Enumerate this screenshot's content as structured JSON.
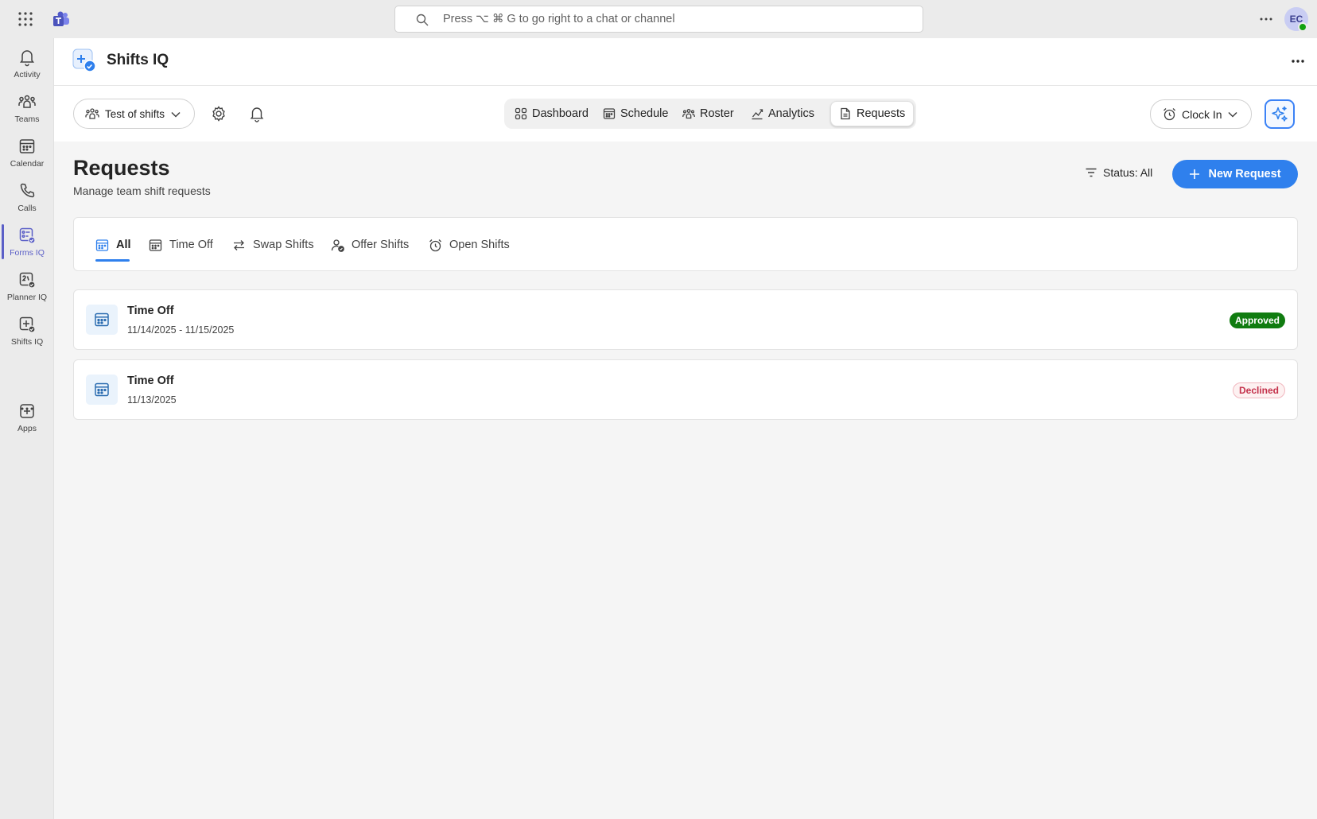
{
  "titlebar": {
    "search_placeholder": "Press ⌥ ⌘ G to go right to a chat or channel",
    "avatar_initials": "EC"
  },
  "rail": {
    "items": [
      {
        "label": "Activity",
        "icon": "bell-icon"
      },
      {
        "label": "Teams",
        "icon": "people-team-icon"
      },
      {
        "label": "Calendar",
        "icon": "calendar-icon"
      },
      {
        "label": "Calls",
        "icon": "phone-icon"
      },
      {
        "label": "Forms IQ",
        "icon": "forms-iq-icon"
      },
      {
        "label": "Planner IQ",
        "icon": "planner-iq-icon"
      },
      {
        "label": "Shifts IQ",
        "icon": "shifts-iq-icon"
      },
      {
        "label": "Apps",
        "icon": "add-apps-icon"
      }
    ],
    "active": "Forms IQ"
  },
  "app": {
    "title": "Shifts IQ"
  },
  "toolbar": {
    "team_select": "Test of shifts",
    "nav": [
      {
        "label": "Dashboard",
        "icon": "grid-icon"
      },
      {
        "label": "Schedule",
        "icon": "calendar-icon"
      },
      {
        "label": "Roster",
        "icon": "people-icon"
      },
      {
        "label": "Analytics",
        "icon": "chart-line-icon"
      },
      {
        "label": "Requests",
        "icon": "document-icon"
      }
    ],
    "active_nav": "Requests",
    "clock_in": "Clock In"
  },
  "page": {
    "title": "Requests",
    "subtitle": "Manage team shift requests",
    "status_filter": "Status: All",
    "new_request": "New Request"
  },
  "tabs": [
    {
      "label": "All",
      "icon": "calendar-grid-icon"
    },
    {
      "label": "Time Off",
      "icon": "calendar-icon"
    },
    {
      "label": "Swap Shifts",
      "icon": "swap-arrows-icon"
    },
    {
      "label": "Offer Shifts",
      "icon": "person-check-icon"
    },
    {
      "label": "Open Shifts",
      "icon": "alarm-clock-icon"
    }
  ],
  "active_tab": "All",
  "requests": [
    {
      "type": "Time Off",
      "date": "11/14/2025 - 11/15/2025",
      "status": "Approved"
    },
    {
      "type": "Time Off",
      "date": "11/13/2025",
      "status": "Declined"
    }
  ],
  "colors": {
    "accent": "#2f80ed",
    "rail_active": "#5b5fc7",
    "approved": "#107c10",
    "declined": "#c4314b"
  }
}
